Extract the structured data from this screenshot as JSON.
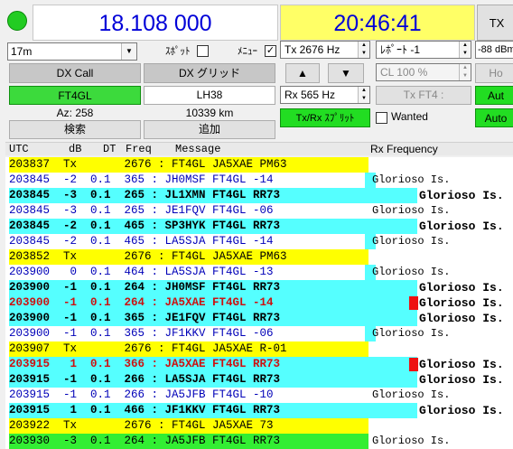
{
  "status": {
    "freq": "18.108 000",
    "time": "20:46:41",
    "tx_label": "TX"
  },
  "controls": {
    "band": "17m",
    "spot_label": "ｽﾎﾟｯﾄ",
    "menu_label": "ﾒﾆｭｰ",
    "menu_check": "✓",
    "tx_hz": "Tx  2676  Hz",
    "report": "ﾚﾎﾟｰﾄ -1",
    "power": "-88 dBm",
    "up": "▲",
    "down": "▼",
    "cl": "CL  100 %",
    "hold": "Ho",
    "rx_hz": "Rx  565  Hz",
    "tx_ft4": "Tx FT4 :",
    "auto1": "Aut",
    "split": "Tx/Rx ｽﾌﾟﾘｯﾄ",
    "wanted": "Wanted",
    "auto2": "Auto"
  },
  "dx": {
    "call_btn": "DX Call",
    "grid_btn": "DX グリッド",
    "call": "FT4GL",
    "grid": "LH38",
    "az": "Az: 258",
    "dist": "10339 km",
    "search": "検索",
    "add": "追加"
  },
  "header": {
    "utc": "UTC",
    "db": "dB",
    "dt": "DT",
    "freq": "Freq",
    "message": "Message",
    "rx": "Rx Frequency"
  },
  "colors": {
    "yellow": "#ffff00",
    "cyan": "#55ffff",
    "green": "#33ee33",
    "red": "#cc1111"
  },
  "rows": [
    {
      "text": "203837  Tx       2676 : FT4GL JA5XAE PM63",
      "loc": ""
    },
    {
      "text": "203845  -2  0.1  365 : JH0MSF FT4GL -14",
      "loc": "Glorioso Is."
    },
    {
      "text": "203845  -3  0.1  265 : JL1XMN FT4GL RR73",
      "loc": "Glorioso Is."
    },
    {
      "text": "203845  -3  0.1  265 : JE1FQV FT4GL -06",
      "loc": "Glorioso Is."
    },
    {
      "text": "203845  -2  0.1  465 : SP3HYK FT4GL RR73",
      "loc": "Glorioso Is."
    },
    {
      "text": "203845  -2  0.1  465 : LA5SJA FT4GL -14",
      "loc": "Glorioso Is."
    },
    {
      "text": "203852  Tx       2676 : FT4GL JA5XAE PM63",
      "loc": ""
    },
    {
      "text": "203900   0  0.1  464 : LA5SJA FT4GL -13",
      "loc": "Glorioso Is."
    },
    {
      "text": "203900  -1  0.1  264 : JH0MSF FT4GL RR73",
      "loc": "Glorioso Is."
    },
    {
      "text": "203900  -1  0.1  264 : JA5XAE FT4GL -14",
      "loc": "Glorioso Is."
    },
    {
      "text": "203900  -1  0.1  365 : JE1FQV FT4GL RR73",
      "loc": "Glorioso Is."
    },
    {
      "text": "203900  -1  0.1  365 : JF1KKV FT4GL -06",
      "loc": "Glorioso Is."
    },
    {
      "text": "203907  Tx       2676 : FT4GL JA5XAE R-01",
      "loc": ""
    },
    {
      "text": "203915   1  0.1  366 : JA5XAE FT4GL RR73",
      "loc": "Glorioso Is."
    },
    {
      "text": "203915  -1  0.1  266 : LA5SJA FT4GL RR73",
      "loc": "Glorioso Is."
    },
    {
      "text": "203915  -1  0.1  266 : JA5JFB FT4GL -10",
      "loc": "Glorioso Is."
    },
    {
      "text": "203915   1  0.1  466 : JF1KKV FT4GL RR73",
      "loc": "Glorioso Is."
    },
    {
      "text": "203922  Tx       2676 : FT4GL JA5XAE 73",
      "loc": ""
    },
    {
      "text": "203930  -3  0.1  264 : JA5JFB FT4GL RR73",
      "loc": "Glorioso Is."
    }
  ]
}
